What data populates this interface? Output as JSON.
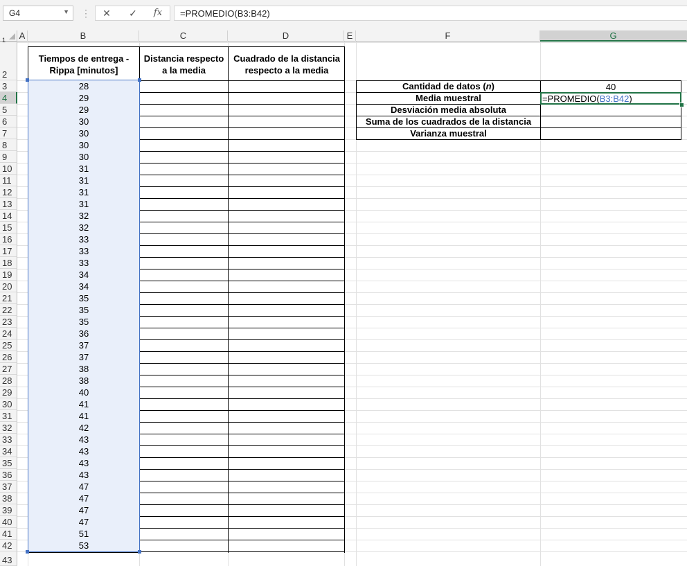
{
  "formula_bar": {
    "name_box": "G4",
    "formula": "=PROMEDIO(B3:B42)",
    "cancel_glyph": "✕",
    "enter_glyph": "✓",
    "fx_label": "fx"
  },
  "columns": [
    "A",
    "B",
    "C",
    "D",
    "E",
    "F",
    "G"
  ],
  "rows": [
    "1",
    "2",
    "3",
    "4",
    "5",
    "6",
    "7",
    "8",
    "9",
    "10",
    "11",
    "12",
    "13",
    "14",
    "15",
    "16",
    "17",
    "18",
    "19",
    "20",
    "21",
    "22",
    "23",
    "24",
    "25",
    "26",
    "27",
    "28",
    "29",
    "30",
    "31",
    "32",
    "33",
    "34",
    "35",
    "36",
    "37",
    "38",
    "39",
    "40",
    "41",
    "42",
    "43"
  ],
  "table": {
    "header_b_line1": "Tiempos de entrega -",
    "header_b_line2": "Rippa [minutos]",
    "header_c_line1": "Distancia respecto",
    "header_c_line2": "a la media",
    "header_d_line1": "Cuadrado de la distancia",
    "header_d_line2": "respecto a la media",
    "values": [
      "28",
      "29",
      "29",
      "30",
      "30",
      "30",
      "30",
      "31",
      "31",
      "31",
      "31",
      "32",
      "32",
      "33",
      "33",
      "33",
      "34",
      "34",
      "35",
      "35",
      "35",
      "36",
      "37",
      "37",
      "38",
      "38",
      "40",
      "41",
      "41",
      "42",
      "43",
      "43",
      "43",
      "43",
      "47",
      "47",
      "47",
      "47",
      "51",
      "53"
    ]
  },
  "summary": {
    "label_count_prefix": "Cantidad de datos (",
    "label_count_n": "n",
    "label_count_suffix": ")",
    "label_mean": "Media muestral",
    "label_mad": "Desviación media absoluta",
    "label_sumsq": "Suma de los cuadrados de la distancia",
    "label_var": "Varianza muestral",
    "count_value": "40",
    "editing_prefix": "=PROMEDIO(",
    "editing_ref": "B3:B42",
    "editing_suffix": ")"
  }
}
